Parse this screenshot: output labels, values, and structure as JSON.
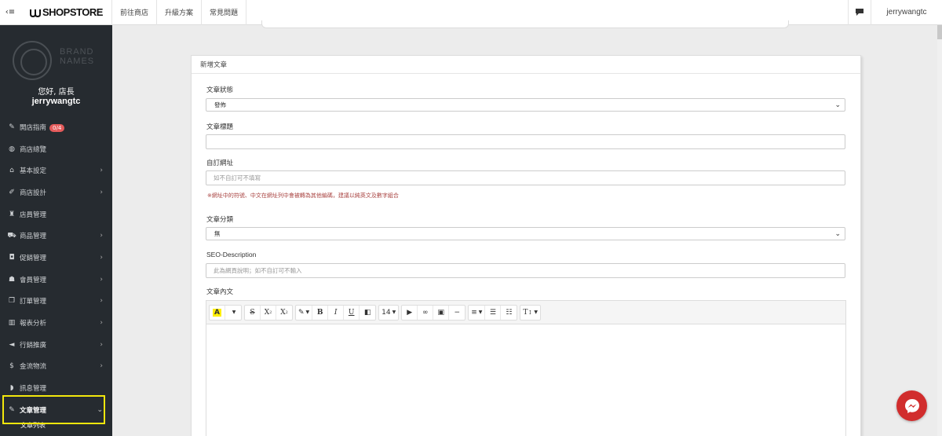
{
  "topbar": {
    "toggle_icon": "‹≡",
    "logo_text": "SHOPSTORE",
    "nav": [
      "前往商店",
      "升級方案",
      "常見問題"
    ],
    "user": "jerrywangtc"
  },
  "sidebar": {
    "brand_line1": "BRAND",
    "brand_line2": "NAMES",
    "greeting": "您好, 店長",
    "username": "jerrywangtc",
    "items": [
      {
        "label": "開店指南",
        "icon": "wrench-icon",
        "glyph": "✎",
        "badge": "0/4",
        "chevron": false
      },
      {
        "label": "商店總覽",
        "icon": "dashboard-icon",
        "glyph": "◍",
        "chevron": false
      },
      {
        "label": "基本設定",
        "icon": "bank-icon",
        "glyph": "⌂",
        "chevron": true
      },
      {
        "label": "商店設計",
        "icon": "magic-wand-icon",
        "glyph": "✐",
        "chevron": true
      },
      {
        "label": "店員管理",
        "icon": "user-lock-icon",
        "glyph": "♜",
        "chevron": false
      },
      {
        "label": "商品管理",
        "icon": "cart-icon",
        "glyph": "⛟",
        "chevron": true
      },
      {
        "label": "促銷管理",
        "icon": "gift-icon",
        "glyph": "◘",
        "chevron": true
      },
      {
        "label": "會員管理",
        "icon": "users-icon",
        "glyph": "☗",
        "chevron": true
      },
      {
        "label": "訂單管理",
        "icon": "copy-icon",
        "glyph": "❐",
        "chevron": true
      },
      {
        "label": "報表分析",
        "icon": "bar-chart-icon",
        "glyph": "▥",
        "chevron": true
      },
      {
        "label": "行銷推廣",
        "icon": "bullhorn-icon",
        "glyph": "◄",
        "chevron": true
      },
      {
        "label": "金流物流",
        "icon": "dollar-icon",
        "glyph": "$",
        "chevron": true
      },
      {
        "label": "訊息管理",
        "icon": "comments-icon",
        "glyph": "◗",
        "chevron": false
      },
      {
        "label": "文章管理",
        "icon": "edit-icon",
        "glyph": "✎",
        "chevron": true,
        "active": true
      }
    ],
    "sub_item": "文章列表"
  },
  "panel": {
    "title": "新增文章",
    "status_label": "文章狀態",
    "status_value": "發佈",
    "title_label": "文章標題",
    "title_value": "",
    "url_label": "自訂網址",
    "url_placeholder": "如不自訂可不填寫",
    "url_hint": "※網址中的符號、中文在網址列中會被轉為其他編碼，建議以純英文及數字組合",
    "category_label": "文章分類",
    "category_value": "無",
    "seo_label": "SEO-Description",
    "seo_placeholder": "此為網頁說明；如不自訂可不輸入",
    "content_label": "文章內文",
    "toolbar": {
      "highlight": "A",
      "strike": "S",
      "sup": "X",
      "sub": "X",
      "bold": "B",
      "italic": "I",
      "underline": "U",
      "font_size": "14",
      "line_height": "T"
    }
  },
  "colors": {
    "sidebar_bg": "#262b30",
    "badge": "#e45b5b",
    "highlight_box": "#f3e70c",
    "messenger": "#d12d2d",
    "hint": "#a94442"
  }
}
